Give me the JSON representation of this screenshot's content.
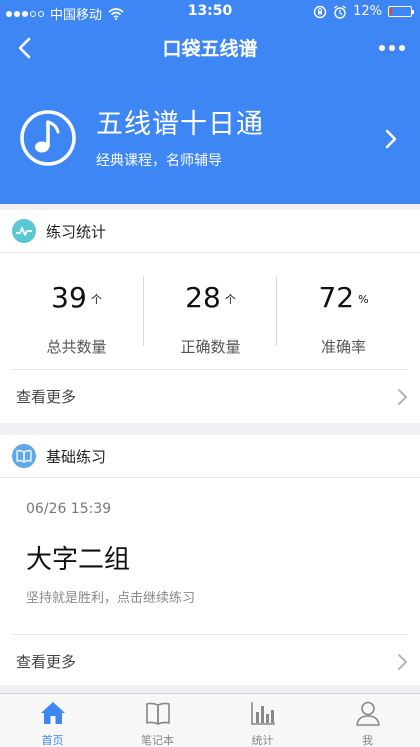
{
  "status_bar": {
    "carrier": "中国移动",
    "time": "13:50",
    "battery_percent": "12%",
    "battery_level": 0.12,
    "battery_color": "#ff3b30",
    "icons": [
      "signal-dots-icon",
      "wifi-icon",
      "rotation-lock-icon",
      "alarm-icon",
      "battery-icon"
    ]
  },
  "nav": {
    "title": "口袋五线谱",
    "back_icon": "chevron-left-icon",
    "more_icon": "more-dots-icon"
  },
  "banner": {
    "icon": "music-note-icon",
    "title": "五线谱十日通",
    "subtitle": "经典课程，名师辅导",
    "arrow_icon": "chevron-right-icon"
  },
  "stats_card": {
    "title": "练习统计",
    "icon": "stats-chart-icon",
    "stats": [
      {
        "value": "39",
        "unit": "个",
        "label": "总共数量"
      },
      {
        "value": "28",
        "unit": "个",
        "label": "正确数量"
      },
      {
        "value": "72",
        "unit": "%",
        "label": "准确率"
      }
    ],
    "more_label": "查看更多"
  },
  "basic_card": {
    "title": "基础练习",
    "icon": "book-icon",
    "date": "06/26 15:39",
    "practice_name": "大字二组",
    "practice_desc": "坚持就是胜利，点击继续练习",
    "more_label": "查看更多"
  },
  "tabs": [
    {
      "label": "首页",
      "icon": "home-icon",
      "active": true
    },
    {
      "label": "笔记本",
      "icon": "notebook-icon",
      "active": false
    },
    {
      "label": "统计",
      "icon": "bar-chart-icon",
      "active": false
    },
    {
      "label": "我",
      "icon": "user-icon",
      "active": false
    }
  ],
  "colors": {
    "primary": "#3f86f5",
    "background": "#efeff4",
    "tab_inactive": "#888888"
  }
}
